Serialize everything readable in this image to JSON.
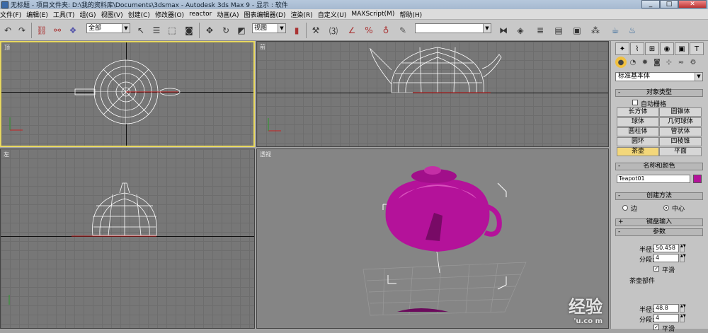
{
  "window": {
    "title": "无标题   - 项目文件夹: D:\\我的资料库\\Documents\\3dsmax    - Autodesk 3ds Max 9    - 显示 : 软件",
    "controls": [
      "_",
      "□",
      "✕"
    ]
  },
  "menu": [
    "文件(F)",
    "编辑(E)",
    "工具(T)",
    "组(G)",
    "视图(V)",
    "创建(C)",
    "修改器(O)",
    "reactor",
    "动画(A)",
    "图表编辑器(D)",
    "渲染(R)",
    "自定义(U)",
    "MAXScript(M)",
    "帮助(H)"
  ],
  "toolbar": {
    "selection_filter": "全部",
    "reference_coord": "视图",
    "named_selection": "",
    "icons": [
      "undo-icon",
      "redo-icon",
      "link-icon",
      "unlink-icon",
      "bind-spacewarp-icon",
      "select-icon",
      "select-by-name-icon",
      "region-select-icon",
      "window-crossing-icon",
      "move-icon",
      "rotate-icon",
      "scale-icon",
      "pivot-icon",
      "select-manipulate-icon",
      "snap-icon",
      "angle-snap-icon",
      "percent-snap-icon",
      "spinner-snap-icon",
      "edit-named-selection-icon",
      "mirror-icon",
      "align-icon",
      "layer-manager-icon",
      "curve-editor-icon",
      "schematic-view-icon",
      "material-editor-icon",
      "render-scene-icon",
      "quick-render-icon"
    ]
  },
  "viewports": {
    "top": {
      "label": "顶"
    },
    "front": {
      "label": "前"
    },
    "left": {
      "label": "左"
    },
    "perspective": {
      "label": "透视"
    }
  },
  "command_panel": {
    "tabs": [
      "create-icon",
      "modify-icon",
      "hierarchy-icon",
      "motion-icon",
      "display-icon",
      "utilities-icon"
    ],
    "subcategories": [
      "geometry-icon",
      "shapes-icon",
      "lights-icon",
      "cameras-icon",
      "helpers-icon",
      "spacewarps-icon",
      "systems-icon"
    ],
    "primitive_type": "标准基本体",
    "object_type": {
      "title": "对象类型",
      "autogrid": "自动栅格",
      "buttons": [
        "长方体",
        "圆锥体",
        "球体",
        "几何球体",
        "圆柱体",
        "管状体",
        "圆环",
        "四棱锥",
        "茶壶",
        "平面"
      ],
      "active": "茶壶"
    },
    "name_color": {
      "title": "名称和颜色",
      "name": "Teapot01",
      "color": "#b4129a"
    },
    "creation_method": {
      "title": "创建方法",
      "options": [
        "边",
        "中心"
      ],
      "selected": "中心"
    },
    "keyboard_entry": {
      "title": "键盘输入"
    },
    "parameters": {
      "title": "参数",
      "radius_label": "半径:",
      "radius_value": "50.458",
      "segments_label": "分段:",
      "segments_value": "4",
      "smooth_label": "平滑",
      "parts_label": "茶壶部件",
      "radius2_label": "半径:",
      "radius2_value": "48.8",
      "segments2_label": "分段:",
      "segments2_value": "4",
      "smooth2_label": "平滑"
    }
  },
  "watermark": {
    "text": "经验",
    "sub": "'u.co m"
  },
  "colors": {
    "teapot": "#b4129a",
    "selection_border": "#e8d860",
    "axis_red": "#c82020"
  }
}
